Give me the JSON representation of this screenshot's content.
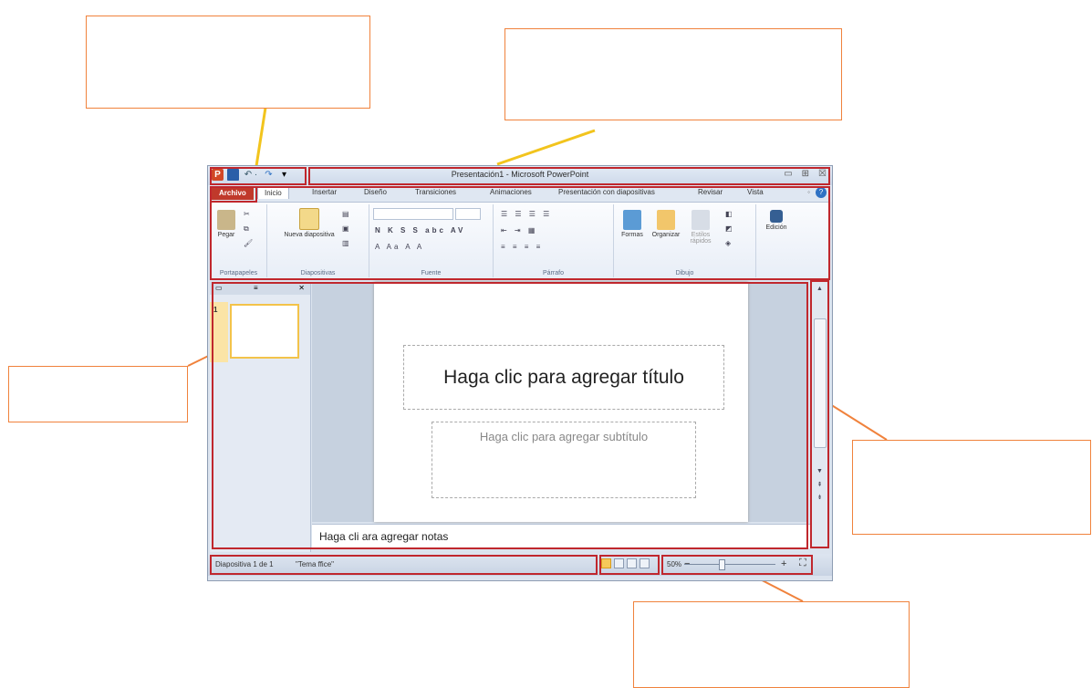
{
  "window": {
    "title": "Presentación1 - Microsoft PowerPoint",
    "minimize": "▭",
    "maximize": "⊞",
    "close": "☒"
  },
  "qat": {
    "undo": "↶ ·",
    "redo": "↷",
    "customize": "▾"
  },
  "tabs": [
    {
      "label": "Archivo"
    },
    {
      "label": "Inicio"
    },
    {
      "label": "Insertar"
    },
    {
      "label": "Diseño"
    },
    {
      "label": "Transiciones"
    },
    {
      "label": "Animaciones"
    },
    {
      "label": "Presentación con diapositivas"
    },
    {
      "label": "Revisar"
    },
    {
      "label": "Vista"
    }
  ],
  "ribbon": {
    "portapapeles": {
      "label": "Portapapeles",
      "paste": "Pegar"
    },
    "diapositivas": {
      "label": "Diapositivas",
      "new_slide": "Nueva diapositiva"
    },
    "fuente": {
      "label": "Fuente",
      "format_row": "N K S S abc AV",
      "size_row": "A Aa A A"
    },
    "parrafo": {
      "label": "Párrafo",
      "list_row": "☰ ☰ ☰ ☰",
      "align_row": "≡ ≡ ≡ ≡"
    },
    "dibujo": {
      "label": "Dibujo",
      "shapes": "Formas",
      "arrange": "Organizar",
      "quick_styles": "Estilos rápidos"
    },
    "edicion": {
      "label": "Edición"
    }
  },
  "slides_pane": {
    "slide_number": "1",
    "close": "✕"
  },
  "slide": {
    "title_placeholder": "Haga clic para agregar título",
    "subtitle_placeholder": "Haga clic para agregar subtítulo"
  },
  "notes": {
    "placeholder": "Haga cli  ara agregar notas"
  },
  "status": {
    "slide_count": "Diapositiva 1 de 1",
    "theme": "\"Tema   ffice\"",
    "zoom": "50%",
    "zoom_out": "−",
    "zoom_in": "+"
  },
  "colors": {
    "callout_border": "#f0823c",
    "highlight": "#c0272d",
    "connector": "#f2c41d"
  }
}
